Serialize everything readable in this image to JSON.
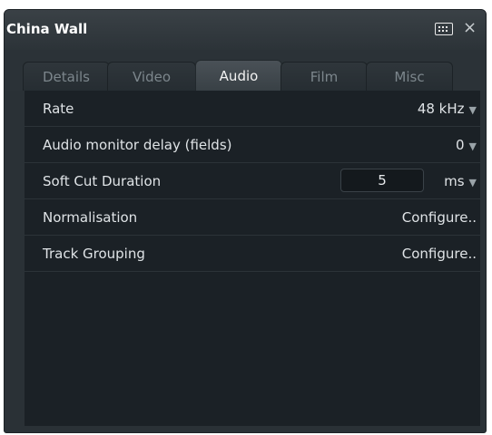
{
  "window": {
    "title": "China Wall",
    "close_glyph": "×"
  },
  "tabs": [
    {
      "label": "Details",
      "active": false
    },
    {
      "label": "Video",
      "active": false
    },
    {
      "label": "Audio",
      "active": true
    },
    {
      "label": "Film",
      "active": false
    },
    {
      "label": "Misc",
      "active": false
    }
  ],
  "audio": {
    "rows": [
      {
        "label": "Rate",
        "value": "48 kHz"
      },
      {
        "label": "Audio monitor delay (fields)",
        "value": "0"
      },
      {
        "label": "Soft Cut Duration",
        "value": "5",
        "unit": "ms"
      },
      {
        "label": "Normalisation",
        "value": "Configure.."
      },
      {
        "label": "Track Grouping",
        "value": "Configure.."
      }
    ]
  },
  "icons": {
    "keyboard": "keyboard-icon",
    "close": "close-icon",
    "dropdown": "chevron-down-icon"
  },
  "colors": {
    "window_bg": "#2a3136",
    "panel_bg": "#1b2126",
    "active_tab": "#4a5157",
    "text": "#dfe3e6"
  }
}
